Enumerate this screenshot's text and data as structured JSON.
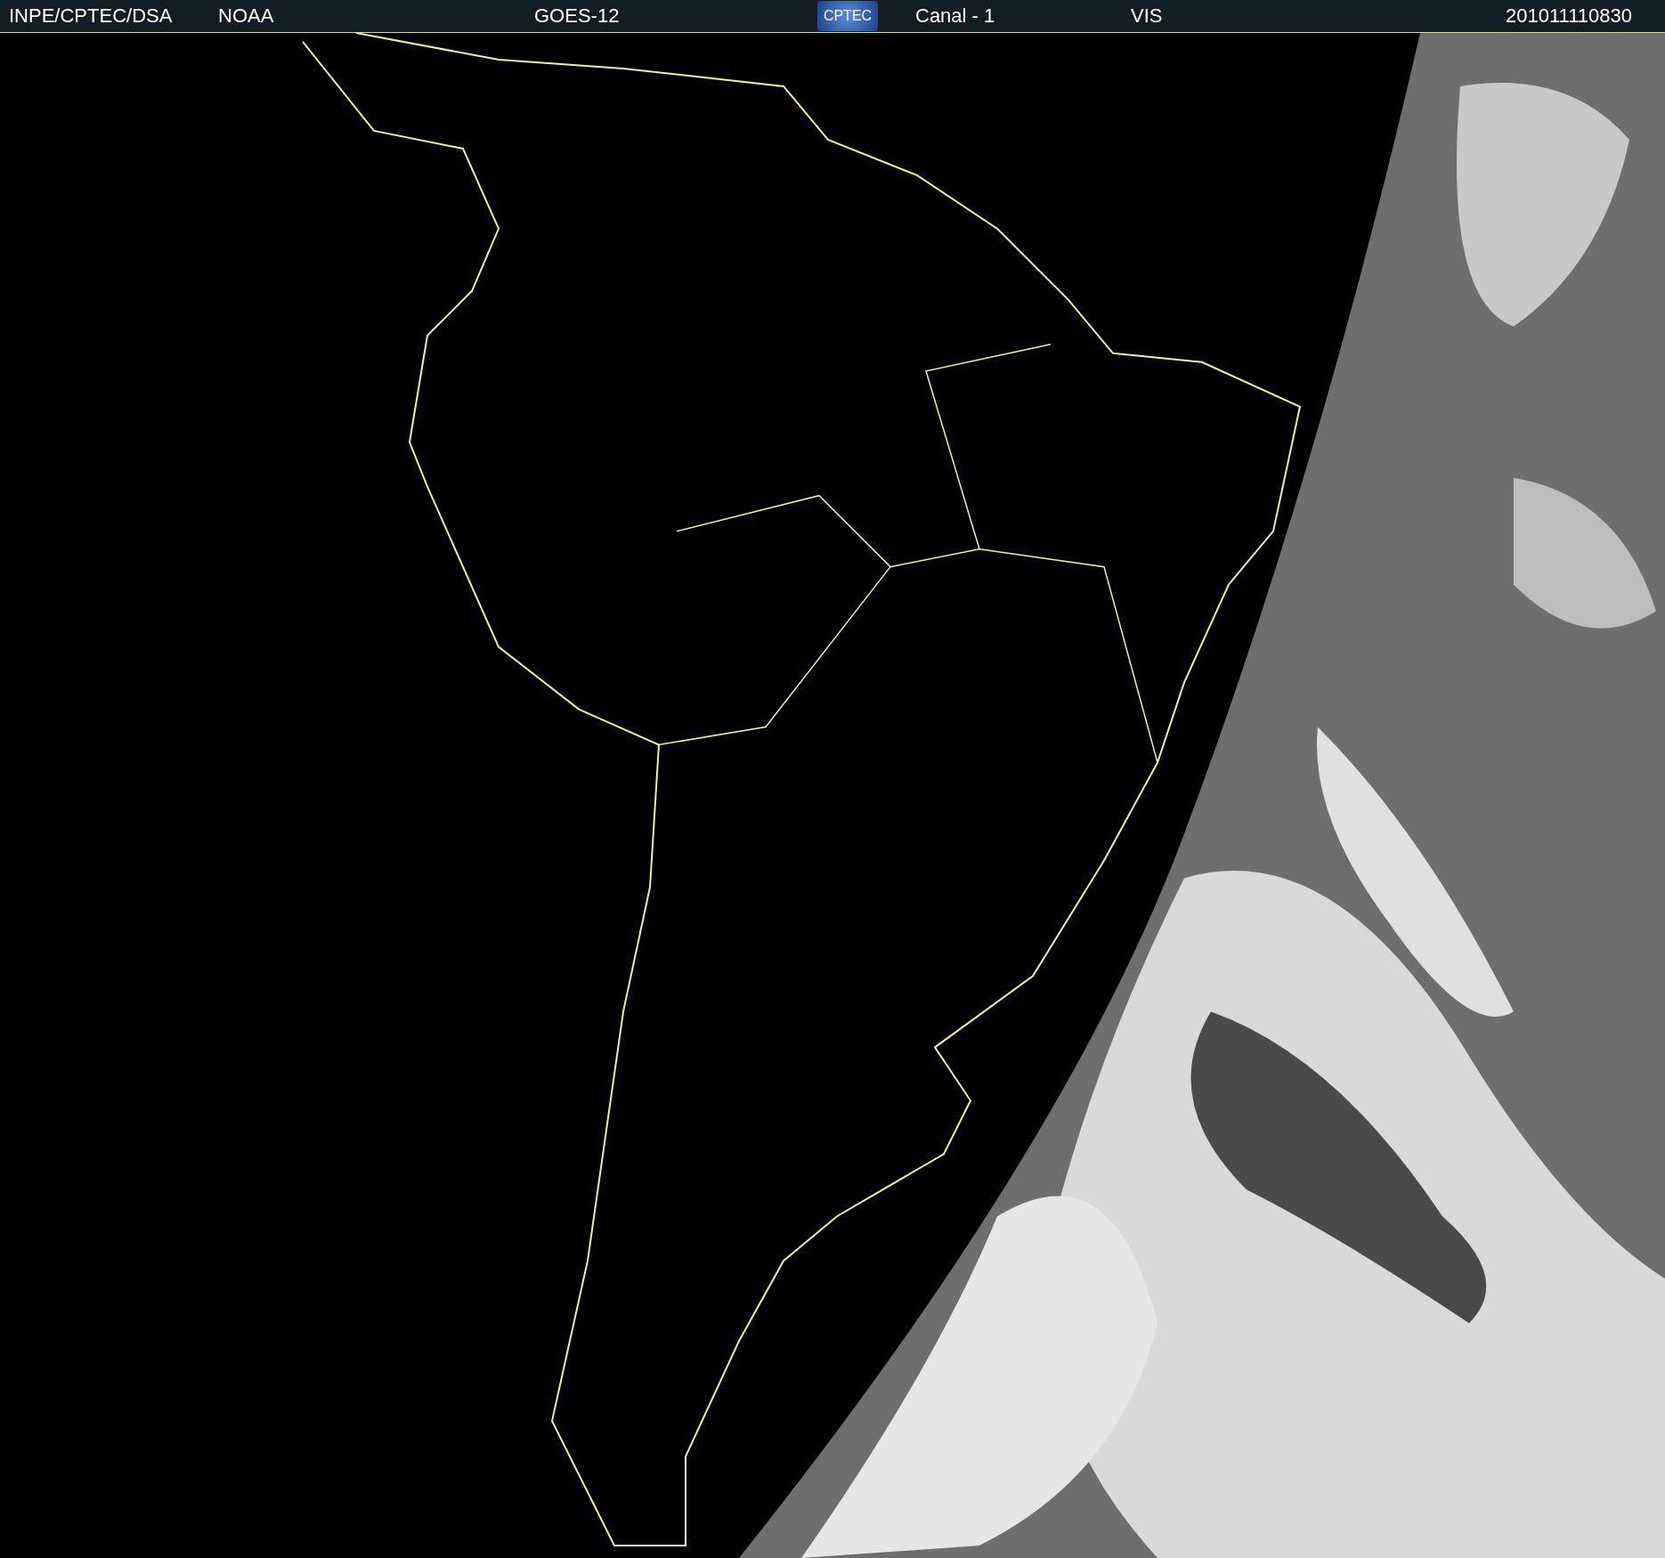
{
  "header": {
    "agency": "INPE/CPTEC/DSA",
    "source": "NOAA",
    "satellite": "GOES-12",
    "logo": "CPTEC",
    "channel": "Canal - 1",
    "band": "VIS",
    "timestamp": "201011110830"
  }
}
